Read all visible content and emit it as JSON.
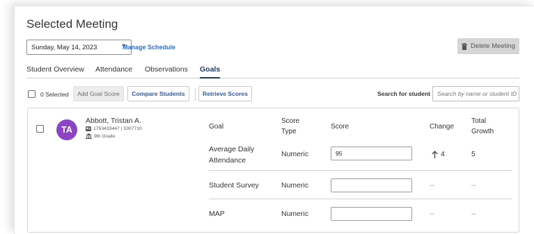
{
  "page": {
    "title": "Selected Meeting"
  },
  "meeting": {
    "date": "Sunday, May 14, 2023",
    "manage_schedule": "Manage Schedule",
    "delete_label": "Delete Meeting"
  },
  "tabs": [
    {
      "label": "Student Overview",
      "active": false
    },
    {
      "label": "Attendance",
      "active": false
    },
    {
      "label": "Observations",
      "active": false
    },
    {
      "label": "Goals",
      "active": true
    }
  ],
  "toolbar": {
    "selected_count": "0 Selected",
    "add_goal_score": "Add Goal Score",
    "compare_students": "Compare Students",
    "retrieve_scores": "Retrieve Scores",
    "search_label": "Search for student",
    "search_placeholder": "Search by name or student ID"
  },
  "student": {
    "initials": "TA",
    "name": "Abbott, Tristan A.",
    "ids": "1753433447 | 5307710",
    "grade": "9th Grade",
    "avatar_color": "#8d44c4"
  },
  "goals_table": {
    "headers": {
      "goal": "Goal",
      "score_type_1": "Score",
      "score_type_2": "Type",
      "score": "Score",
      "change": "Change",
      "growth_1": "Total",
      "growth_2": "Growth"
    },
    "rows": [
      {
        "goal_1": "Average Daily",
        "goal_2": "Attendance",
        "score_type": "Numeric",
        "score": "95",
        "change": "4",
        "change_direction": "up",
        "total_growth": "5"
      },
      {
        "goal_1": "Student Survey",
        "goal_2": "",
        "score_type": "Numeric",
        "score": "",
        "change": "--",
        "total_growth": "--"
      },
      {
        "goal_1": "MAP",
        "goal_2": "",
        "score_type": "Numeric",
        "score": "",
        "change": "--",
        "total_growth": "--"
      }
    ]
  },
  "colors": {
    "accent": "#1f3a6b",
    "link": "#2f6fd6",
    "button_text": "#2f5aa8"
  }
}
